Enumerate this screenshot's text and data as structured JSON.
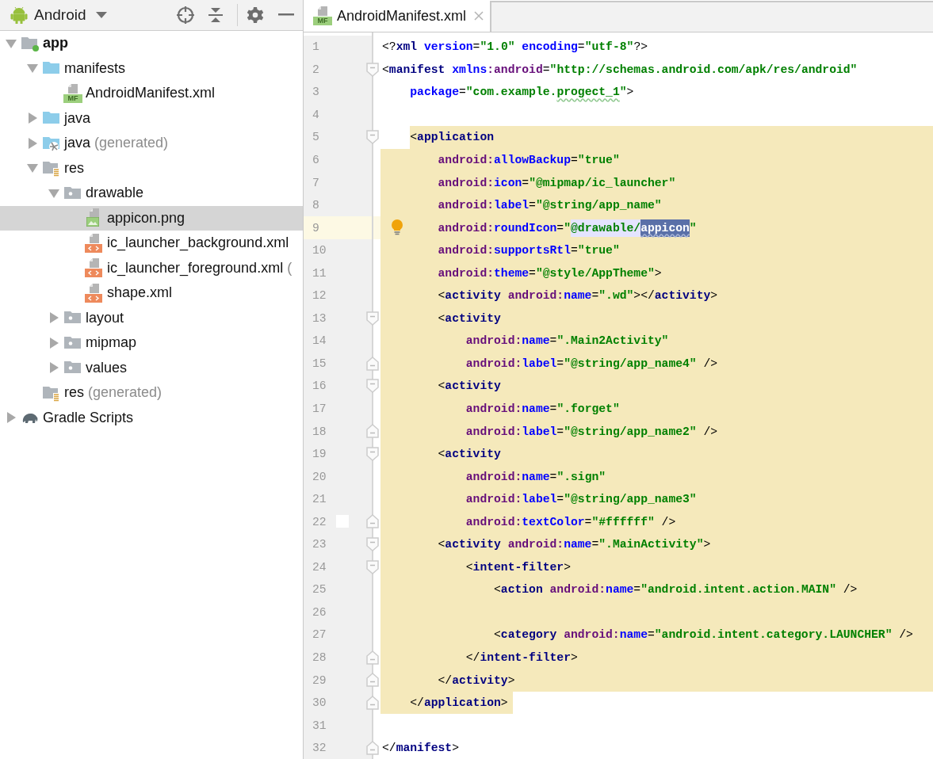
{
  "project_panel": {
    "view": "Android",
    "tree": [
      {
        "label": "app",
        "bold": true,
        "kind": "module",
        "expanded": true,
        "selected": false,
        "children": [
          {
            "label": "manifests",
            "kind": "folder",
            "expanded": true,
            "selected": false,
            "children": [
              {
                "label": "AndroidManifest.xml",
                "kind": "manifest",
                "badge": "MF",
                "selected": false
              }
            ]
          },
          {
            "label": "java",
            "kind": "folder",
            "expanded": false,
            "selected": false
          },
          {
            "label": "java",
            "suffix": "(generated)",
            "kind": "generated",
            "expanded": false,
            "selected": false
          },
          {
            "label": "res",
            "kind": "resources",
            "expanded": true,
            "selected": false,
            "children": [
              {
                "label": "drawable",
                "kind": "subfolder",
                "expanded": true,
                "selected": false,
                "children": [
                  {
                    "label": "appicon.png",
                    "kind": "image",
                    "selected": true
                  },
                  {
                    "label": "ic_launcher_background.xml",
                    "kind": "xml",
                    "selected": false
                  },
                  {
                    "label": "ic_launcher_foreground.xml",
                    "suffix": "(",
                    "kind": "xml",
                    "selected": false
                  },
                  {
                    "label": "shape.xml",
                    "kind": "xml",
                    "selected": false
                  }
                ]
              },
              {
                "label": "layout",
                "kind": "subfolder",
                "expanded": false,
                "selected": false
              },
              {
                "label": "mipmap",
                "kind": "subfolder",
                "expanded": false,
                "selected": false
              },
              {
                "label": "values",
                "kind": "subfolder",
                "expanded": false,
                "selected": false
              }
            ]
          },
          {
            "label": "res",
            "suffix": "(generated)",
            "kind": "resources",
            "selected": false
          }
        ]
      },
      {
        "label": "Gradle Scripts",
        "kind": "gradle",
        "expanded": false,
        "selected": false
      }
    ]
  },
  "tabs": [
    {
      "label": "AndroidManifest.xml",
      "badge": "MF",
      "selected": true
    }
  ],
  "lines": [
    {
      "number": "1",
      "current": false,
      "tokens": [
        {
          "kind": "punct",
          "text": "<?"
        },
        {
          "kind": "tag",
          "text": "xml"
        },
        {
          "kind": "attr",
          "text": " version"
        },
        {
          "kind": "punct",
          "text": "="
        },
        {
          "kind": "value",
          "text": "\"1.0\""
        },
        {
          "kind": "attr",
          "text": " encoding"
        },
        {
          "kind": "punct",
          "text": "="
        },
        {
          "kind": "value",
          "text": "\"utf-8\""
        },
        {
          "kind": "punct",
          "text": "?>"
        }
      ]
    },
    {
      "number": "2",
      "current": false,
      "fold_start": true,
      "tokens": [
        {
          "kind": "punct",
          "text": "<"
        },
        {
          "kind": "tag",
          "text": "manifest"
        },
        {
          "kind": "attr",
          "text": " xmlns"
        },
        {
          "kind": "namespace",
          "text": ":android"
        },
        {
          "kind": "punct",
          "text": "="
        },
        {
          "kind": "value",
          "text": "\"http://schemas.android.com/apk/res/android\""
        }
      ]
    },
    {
      "number": "3",
      "current": false,
      "tokens": [
        {
          "kind": "attr",
          "text": "    package"
        },
        {
          "kind": "punct",
          "text": "="
        },
        {
          "kind": "value",
          "text": "\"com.example."
        },
        {
          "kind": "typo",
          "text": "progect_1"
        },
        {
          "kind": "value",
          "text": "\""
        },
        {
          "kind": "punct",
          "text": ">"
        }
      ]
    },
    {
      "number": "4",
      "current": false
    },
    {
      "number": "5",
      "current": false,
      "highlighted": true,
      "fold_start": true,
      "tokens": [
        {
          "kind": "punct",
          "text": "    <"
        },
        {
          "kind": "tag",
          "text": "application"
        }
      ]
    },
    {
      "number": "6",
      "current": false,
      "highlighted": true,
      "tokens": [
        {
          "kind": "namespace",
          "text": "        android:"
        },
        {
          "kind": "attr",
          "text": "allowBackup"
        },
        {
          "kind": "punct",
          "text": "="
        },
        {
          "kind": "value",
          "text": "\"true\""
        }
      ]
    },
    {
      "number": "7",
      "current": false,
      "highlighted": true,
      "tokens": [
        {
          "kind": "namespace",
          "text": "        android:"
        },
        {
          "kind": "attr",
          "text": "icon"
        },
        {
          "kind": "punct",
          "text": "="
        },
        {
          "kind": "value",
          "text": "\"@mipmap/ic_launcher\""
        }
      ]
    },
    {
      "number": "8",
      "current": false,
      "highlighted": true,
      "tokens": [
        {
          "kind": "namespace",
          "text": "        android:"
        },
        {
          "kind": "attr",
          "text": "label"
        },
        {
          "kind": "punct",
          "text": "="
        },
        {
          "kind": "value",
          "text": "\"@string/app_name\""
        }
      ]
    },
    {
      "number": "9",
      "current": true,
      "highlighted": true,
      "intention_bulb": true,
      "tokens": [
        {
          "kind": "namespace",
          "text": "        android:"
        },
        {
          "kind": "attr",
          "text": "roundIcon"
        },
        {
          "kind": "punct",
          "text": "="
        },
        {
          "kind": "value",
          "text": "\""
        },
        {
          "kind": "match",
          "text": "@drawable/"
        },
        {
          "kind": "selection",
          "text": "appicon"
        },
        {
          "kind": "value",
          "text": "\""
        }
      ]
    },
    {
      "number": "10",
      "current": false,
      "highlighted": true,
      "tokens": [
        {
          "kind": "namespace",
          "text": "        android:"
        },
        {
          "kind": "attr",
          "text": "supportsRtl"
        },
        {
          "kind": "punct",
          "text": "="
        },
        {
          "kind": "value",
          "text": "\"true\""
        }
      ]
    },
    {
      "number": "11",
      "current": false,
      "highlighted": true,
      "tokens": [
        {
          "kind": "namespace",
          "text": "        android:"
        },
        {
          "kind": "attr",
          "text": "theme"
        },
        {
          "kind": "punct",
          "text": "="
        },
        {
          "kind": "value",
          "text": "\"@style/AppTheme\""
        },
        {
          "kind": "punct",
          "text": ">"
        }
      ]
    },
    {
      "number": "12",
      "current": false,
      "highlighted": true,
      "tokens": [
        {
          "kind": "punct",
          "text": "        <"
        },
        {
          "kind": "tag",
          "text": "activity"
        },
        {
          "kind": "namespace",
          "text": " android:"
        },
        {
          "kind": "attr",
          "text": "name"
        },
        {
          "kind": "punct",
          "text": "="
        },
        {
          "kind": "value",
          "text": "\".wd\""
        },
        {
          "kind": "punct",
          "text": "></"
        },
        {
          "kind": "tag",
          "text": "activity"
        },
        {
          "kind": "punct",
          "text": ">"
        }
      ]
    },
    {
      "number": "13",
      "current": false,
      "highlighted": true,
      "fold_start": true,
      "tokens": [
        {
          "kind": "punct",
          "text": "        <"
        },
        {
          "kind": "tag",
          "text": "activity"
        }
      ]
    },
    {
      "number": "14",
      "current": false,
      "highlighted": true,
      "tokens": [
        {
          "kind": "namespace",
          "text": "            android:"
        },
        {
          "kind": "attr",
          "text": "name"
        },
        {
          "kind": "punct",
          "text": "="
        },
        {
          "kind": "value",
          "text": "\".Main2Activity\""
        }
      ]
    },
    {
      "number": "15",
      "current": false,
      "highlighted": true,
      "fold_end": true,
      "tokens": [
        {
          "kind": "namespace",
          "text": "            android:"
        },
        {
          "kind": "attr",
          "text": "label"
        },
        {
          "kind": "punct",
          "text": "="
        },
        {
          "kind": "value",
          "text": "\"@string/app_name4\""
        },
        {
          "kind": "punct",
          "text": " />"
        }
      ]
    },
    {
      "number": "16",
      "current": false,
      "highlighted": true,
      "fold_start": true,
      "tokens": [
        {
          "kind": "punct",
          "text": "        <"
        },
        {
          "kind": "tag",
          "text": "activity"
        }
      ]
    },
    {
      "number": "17",
      "current": false,
      "highlighted": true,
      "tokens": [
        {
          "kind": "namespace",
          "text": "            android:"
        },
        {
          "kind": "attr",
          "text": "name"
        },
        {
          "kind": "punct",
          "text": "="
        },
        {
          "kind": "value",
          "text": "\".forget\""
        }
      ]
    },
    {
      "number": "18",
      "current": false,
      "highlighted": true,
      "fold_end": true,
      "tokens": [
        {
          "kind": "namespace",
          "text": "            android:"
        },
        {
          "kind": "attr",
          "text": "label"
        },
        {
          "kind": "punct",
          "text": "="
        },
        {
          "kind": "value",
          "text": "\"@string/app_name2\""
        },
        {
          "kind": "punct",
          "text": " />"
        }
      ]
    },
    {
      "number": "19",
      "current": false,
      "highlighted": true,
      "fold_start": true,
      "tokens": [
        {
          "kind": "punct",
          "text": "        <"
        },
        {
          "kind": "tag",
          "text": "activity"
        }
      ]
    },
    {
      "number": "20",
      "current": false,
      "highlighted": true,
      "tokens": [
        {
          "kind": "namespace",
          "text": "            android:"
        },
        {
          "kind": "attr",
          "text": "name"
        },
        {
          "kind": "punct",
          "text": "="
        },
        {
          "kind": "value",
          "text": "\".sign\""
        }
      ]
    },
    {
      "number": "21",
      "current": false,
      "highlighted": true,
      "tokens": [
        {
          "kind": "namespace",
          "text": "            android:"
        },
        {
          "kind": "attr",
          "text": "label"
        },
        {
          "kind": "punct",
          "text": "="
        },
        {
          "kind": "value",
          "text": "\"@string/app_name3\""
        }
      ]
    },
    {
      "number": "22",
      "current": false,
      "highlighted": true,
      "fold_end": true,
      "color": "#ffffff",
      "tokens": [
        {
          "kind": "namespace",
          "text": "            android:"
        },
        {
          "kind": "attr",
          "text": "textColor"
        },
        {
          "kind": "punct",
          "text": "="
        },
        {
          "kind": "value",
          "text": "\"#ffffff\""
        },
        {
          "kind": "punct",
          "text": " />"
        }
      ]
    },
    {
      "number": "23",
      "current": false,
      "highlighted": true,
      "fold_start": true,
      "tokens": [
        {
          "kind": "punct",
          "text": "        <"
        },
        {
          "kind": "tag",
          "text": "activity"
        },
        {
          "kind": "namespace",
          "text": " android:"
        },
        {
          "kind": "attr",
          "text": "name"
        },
        {
          "kind": "punct",
          "text": "="
        },
        {
          "kind": "value",
          "text": "\".MainActivity\""
        },
        {
          "kind": "punct",
          "text": ">"
        }
      ]
    },
    {
      "number": "24",
      "current": false,
      "highlighted": true,
      "fold_start": true,
      "tokens": [
        {
          "kind": "punct",
          "text": "            <"
        },
        {
          "kind": "tag",
          "text": "intent-filter"
        },
        {
          "kind": "punct",
          "text": ">"
        }
      ]
    },
    {
      "number": "25",
      "current": false,
      "highlighted": true,
      "tokens": [
        {
          "kind": "punct",
          "text": "                <"
        },
        {
          "kind": "tag",
          "text": "action"
        },
        {
          "kind": "namespace",
          "text": " android:"
        },
        {
          "kind": "attr",
          "text": "name"
        },
        {
          "kind": "punct",
          "text": "="
        },
        {
          "kind": "value",
          "text": "\"android.intent.action.MAIN\""
        },
        {
          "kind": "punct",
          "text": " />"
        }
      ]
    },
    {
      "number": "26",
      "current": false,
      "highlighted": true
    },
    {
      "number": "27",
      "current": false,
      "highlighted": true,
      "tokens": [
        {
          "kind": "punct",
          "text": "                <"
        },
        {
          "kind": "tag",
          "text": "category"
        },
        {
          "kind": "namespace",
          "text": " android:"
        },
        {
          "kind": "attr",
          "text": "name"
        },
        {
          "kind": "punct",
          "text": "="
        },
        {
          "kind": "value",
          "text": "\"android.intent.category.LAUNCHER\""
        },
        {
          "kind": "punct",
          "text": " />"
        }
      ]
    },
    {
      "number": "28",
      "current": false,
      "highlighted": true,
      "fold_end": true,
      "tokens": [
        {
          "kind": "punct",
          "text": "            </"
        },
        {
          "kind": "tag",
          "text": "intent-filter"
        },
        {
          "kind": "punct",
          "text": ">"
        }
      ]
    },
    {
      "number": "29",
      "current": false,
      "highlighted": true,
      "fold_end": true,
      "tokens": [
        {
          "kind": "punct",
          "text": "        </"
        },
        {
          "kind": "tag",
          "text": "activity"
        },
        {
          "kind": "punct",
          "text": ">"
        }
      ]
    },
    {
      "number": "30",
      "current": false,
      "highlighted": true,
      "fold_end": true,
      "tokens": [
        {
          "kind": "punct",
          "text": "    </"
        },
        {
          "kind": "tag",
          "text": "application"
        },
        {
          "kind": "punct",
          "text": ">"
        }
      ]
    },
    {
      "number": "31",
      "current": false
    },
    {
      "number": "32",
      "current": false,
      "fold_end": true,
      "tokens": [
        {
          "kind": "punct",
          "text": "</"
        },
        {
          "kind": "tag",
          "text": "manifest"
        },
        {
          "kind": "punct",
          "text": ">"
        }
      ]
    }
  ]
}
